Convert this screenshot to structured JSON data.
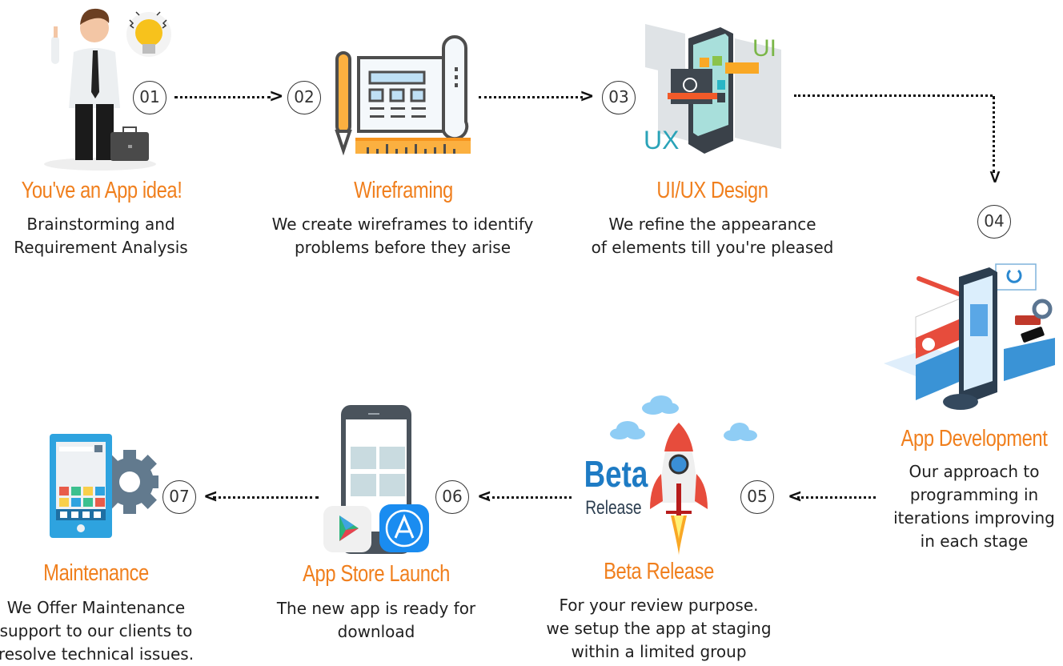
{
  "steps": [
    {
      "number": "01",
      "title": "You've an App idea!",
      "desc_line1": "Brainstorming and",
      "desc_line2": "Requirement Analysis",
      "icon": "businessman-idea-icon"
    },
    {
      "number": "02",
      "title": "Wireframing",
      "desc_line1": "We create wireframes to identify",
      "desc_line2": "problems before they arise",
      "icon": "wireframe-blueprint-icon"
    },
    {
      "number": "03",
      "title": "UI/UX Design",
      "desc_line1": "We refine the appearance",
      "desc_line2": "of elements till you're pleased",
      "icon": "ui-ux-phone-icon"
    },
    {
      "number": "04",
      "title": "App Development",
      "desc_line1": "Our approach to",
      "desc_line2": "programming in",
      "desc_line3": "iterations improving",
      "desc_line4": "in each stage",
      "icon": "app-development-isometric-icon"
    },
    {
      "number": "05",
      "title": "Beta Release",
      "desc_line1": "For your review purpose.",
      "desc_line2": "we setup the app at staging",
      "desc_line3": "within a limited group",
      "icon": "rocket-icon"
    },
    {
      "number": "06",
      "title": "App Store Launch",
      "desc_line1": "The new app is ready for",
      "desc_line2": "download",
      "icon": "app-store-phone-icon"
    },
    {
      "number": "07",
      "title": "Maintenance",
      "desc_line1": "We Offer Maintenance",
      "desc_line2": "support to our clients to",
      "desc_line3": "resolve technical issues.",
      "icon": "tablet-gear-icon"
    }
  ],
  "illustrations": {
    "ui_label": "UI",
    "ux_label": "UX",
    "beta_word": "Beta",
    "release_word": "Release"
  },
  "colors": {
    "title_orange": "#f07f1d",
    "text_dark": "#1f1f1f",
    "beta_blue": "#1e7bc4",
    "ui_green": "#7ab648",
    "ux_teal": "#2aa3b8"
  }
}
